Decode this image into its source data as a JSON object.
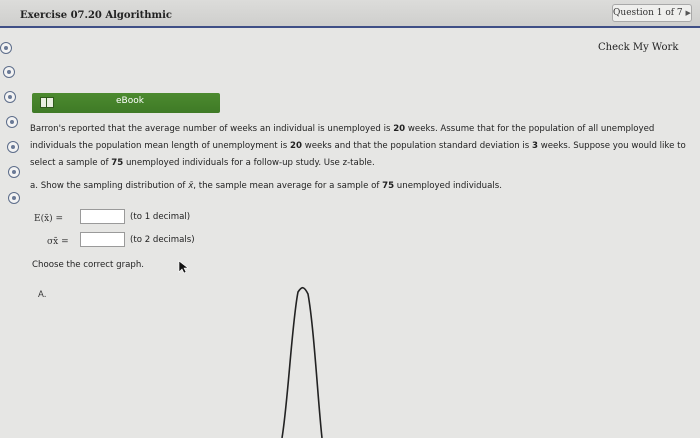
{
  "header": {
    "exercise_title": "Exercise 07.20 Algorithmic",
    "question_nav": "Question 1 of 7",
    "next_arrow": "▶"
  },
  "toolbar": {
    "check_my_work": "Check My Work"
  },
  "ebook": {
    "label": "eBook"
  },
  "problem": {
    "p1": "Barron's reported that the average number of weeks an individual is unemployed is ",
    "mean_weeks": "20",
    "p2": " weeks. Assume that for the population of all unemployed individuals the population mean length of unemployment is ",
    "pop_mean": "20",
    "p3": " weeks and that the population standard deviation is ",
    "pop_sd": "3",
    "p4": " weeks. Suppose you would like to select a sample of ",
    "sample_size": "75",
    "p5": " unemployed individuals for a follow-up study. Use z-table."
  },
  "part_a": {
    "prefix": "a. Show the sampling distribution of ",
    "xbar": "x̄",
    "mid": ", the sample mean average for a sample of ",
    "n": "75",
    "suffix": " unemployed individuals."
  },
  "fields": {
    "expected_label": "E(x̄) =",
    "expected_value": "",
    "expected_hint": "(to 1 decimal)",
    "sigma_label": "σx̄ =",
    "sigma_value": "",
    "sigma_hint": "(to 2 decimals)"
  },
  "choose_graph": "Choose the correct graph.",
  "option_a": "A.",
  "icons": {
    "side_nav": "radio-dot-icon",
    "ebook": "book-icon",
    "cursor": "mouse-pointer-icon"
  },
  "colors": {
    "accent": "#3f4f86",
    "ebook_green": "#4c8a2f"
  }
}
